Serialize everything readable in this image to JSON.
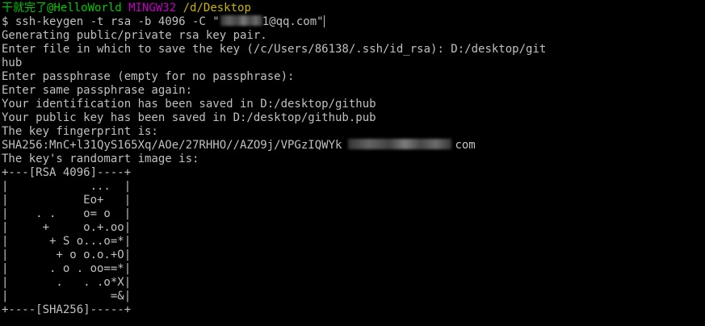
{
  "prompt": {
    "user_host": "干就完了@HelloWorld",
    "system": "MINGW32",
    "path": "/d/Desktop"
  },
  "command": {
    "prefix": "$ ssh-keygen -t rsa -b 4096 -C \"",
    "email_visible_suffix": "1@qq.com\""
  },
  "output": {
    "generating": "Generating public/private rsa key pair.",
    "enter_file": "Enter file in which to save the key (/c/Users/86138/.ssh/id_rsa): D:/desktop/git",
    "enter_file_cont": "hub",
    "enter_passphrase": "Enter passphrase (empty for no passphrase):",
    "enter_same": "Enter same passphrase again:",
    "identification": "Your identification has been saved in D:/desktop/github",
    "public_key": "Your public key has been saved in D:/desktop/github.pub",
    "fingerprint_label": "The key fingerprint is:",
    "fingerprint_prefix": "SHA256:MnC+l31QyS165Xq/AOe/27RHHO//AZO9j/VPGzIQWYk",
    "fingerprint_suffix": "com",
    "randomart_label": "The key's randomart image is:"
  },
  "randomart": [
    "+---[RSA 4096]----+",
    "|            ...  |",
    "|           Eo+   |",
    "|    . .    o= o  |",
    "|     +     o.+.oo|",
    "|      + S o...o=*|",
    "|       + o o.o.+O|",
    "|      . o . oo==*|",
    "|       .   . .o*X|",
    "|               =&|",
    "+----[SHA256]-----+"
  ]
}
